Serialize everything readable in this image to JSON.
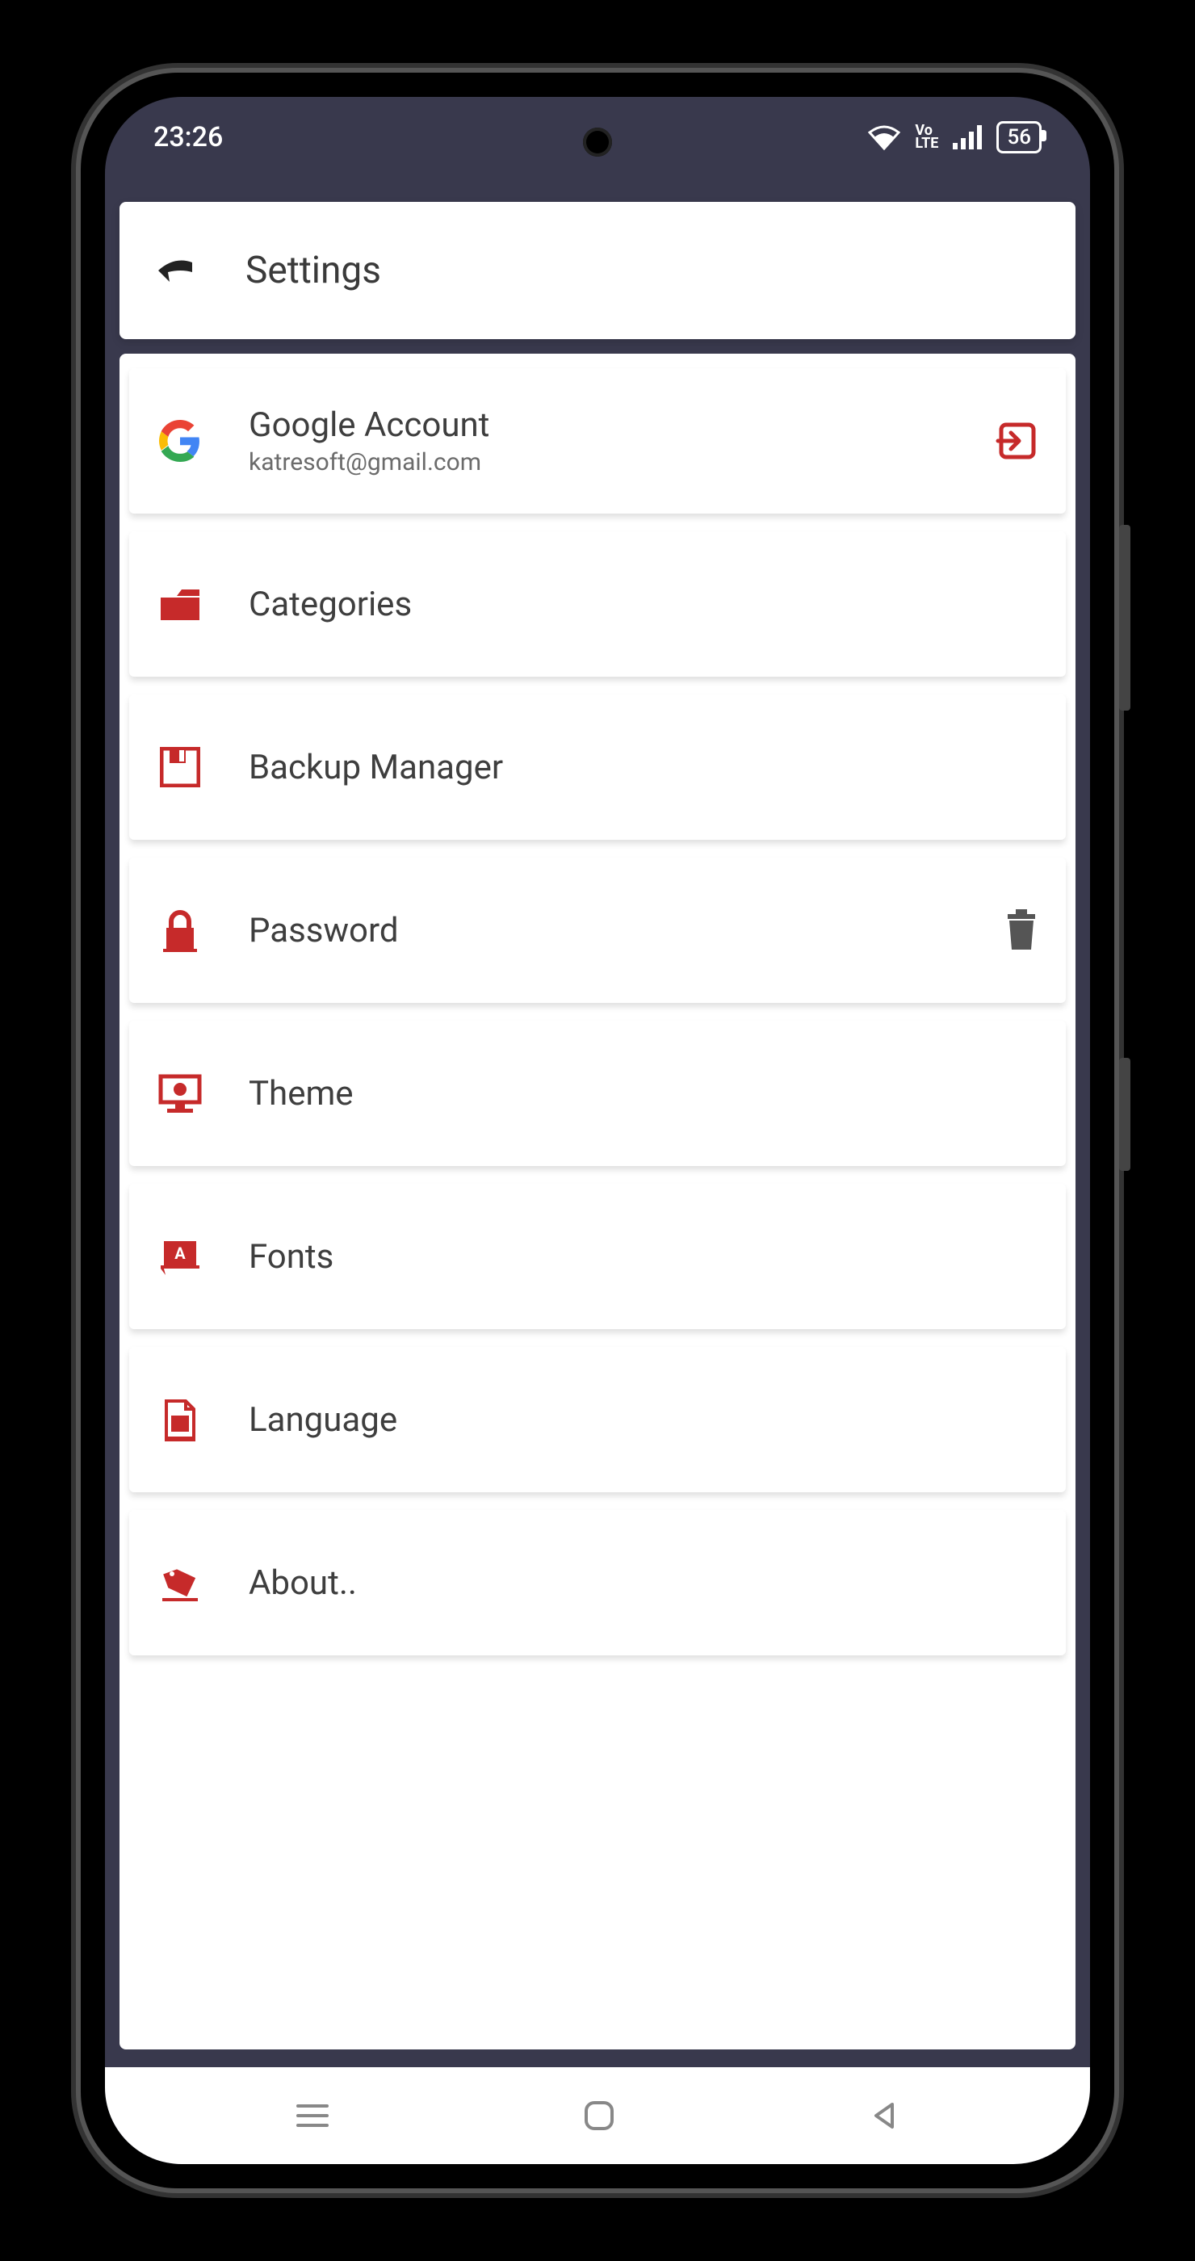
{
  "statusbar": {
    "time": "23:26",
    "volte": "Vo\nLTE",
    "battery": "56"
  },
  "header": {
    "title": "Settings"
  },
  "account": {
    "title": "Google Account",
    "subtitle": "katresoft@gmail.com"
  },
  "items": {
    "categories": {
      "title": "Categories"
    },
    "backup": {
      "title": "Backup Manager"
    },
    "password": {
      "title": "Password"
    },
    "theme": {
      "title": "Theme"
    },
    "fonts": {
      "title": "Fonts"
    },
    "language": {
      "title": "Language"
    },
    "about": {
      "title": "About.."
    }
  },
  "colors": {
    "accent": "#c62a2a",
    "textDark": "#3a3a3a",
    "textMuted": "#6b6b6b",
    "frame": "#39394d"
  }
}
